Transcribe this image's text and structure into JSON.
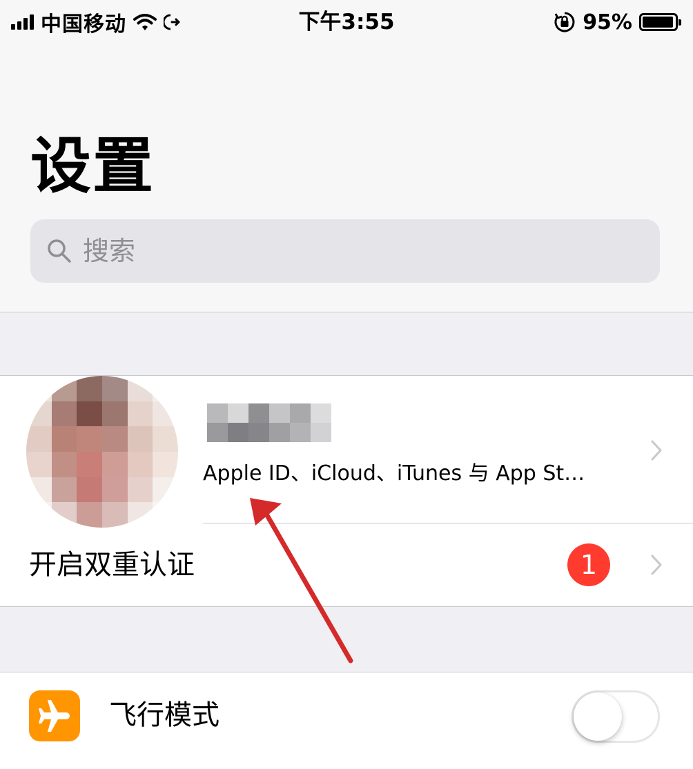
{
  "status_bar": {
    "carrier": "中国移动",
    "time": "下午3:55",
    "battery_percent": "95%",
    "battery_level": 0.95,
    "icons": [
      "signal-icon",
      "wifi-icon",
      "location-arrow-icon",
      "orientation-lock-icon",
      "battery-icon"
    ]
  },
  "header": {
    "title": "设置"
  },
  "search": {
    "placeholder": "搜索",
    "icon": "search-icon"
  },
  "account": {
    "name": "",
    "subtitle": "Apple ID、iCloud、iTunes 与 App St…",
    "avatar": "blurred-avatar"
  },
  "two_factor": {
    "label": "开启双重认证",
    "badge": "1"
  },
  "airplane_mode": {
    "label": "飞行模式",
    "icon": "airplane-icon",
    "enabled": false
  },
  "colors": {
    "accent_badge": "#ff3b30",
    "airplane_icon_bg": "#ff9500",
    "annotation_arrow": "#d42a2a",
    "background": "#efeff4"
  }
}
